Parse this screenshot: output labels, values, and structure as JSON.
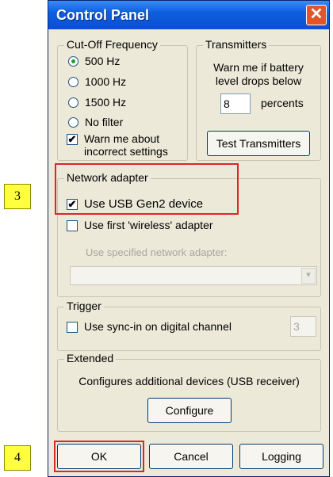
{
  "callouts": {
    "step3": "3",
    "step4": "4"
  },
  "window": {
    "title": "Control Panel",
    "close_glyph": "✕"
  },
  "cutoff": {
    "title": "Cut-Off Frequency",
    "options": [
      {
        "label": "500 Hz",
        "selected": true
      },
      {
        "label": "1000 Hz",
        "selected": false
      },
      {
        "label": "1500 Hz",
        "selected": false
      },
      {
        "label": "No filter",
        "selected": false
      }
    ],
    "warn_checkbox": {
      "label_line1": "Warn me about",
      "label_line2": "incorrect settings",
      "checked": true
    }
  },
  "transmitters": {
    "title": "Transmitters",
    "text_line1": "Warn me if battery",
    "text_line2": "level drops below",
    "value": "8",
    "unit": "percents",
    "test_button": "Test Transmitters"
  },
  "network": {
    "title": "Network adapter",
    "use_usb": {
      "label": "Use USB Gen2 device",
      "checked": true
    },
    "use_wireless": {
      "label": "Use first 'wireless' adapter",
      "checked": false
    },
    "specified_label": "Use specified network adapter:",
    "dropdown_value": ""
  },
  "trigger": {
    "title": "Trigger",
    "sync_in": {
      "label": "Use sync-in on digital channel",
      "checked": false
    },
    "channel_value": "3"
  },
  "extended": {
    "title": "Extended",
    "description": "Configures additional devices (USB receiver)",
    "configure_button": "Configure"
  },
  "buttons": {
    "ok": "OK",
    "cancel": "Cancel",
    "logging": "Logging"
  },
  "colors": {
    "title_bar": "#0b4ed1",
    "highlight": "#e0242a",
    "callout": "#ffff40"
  }
}
